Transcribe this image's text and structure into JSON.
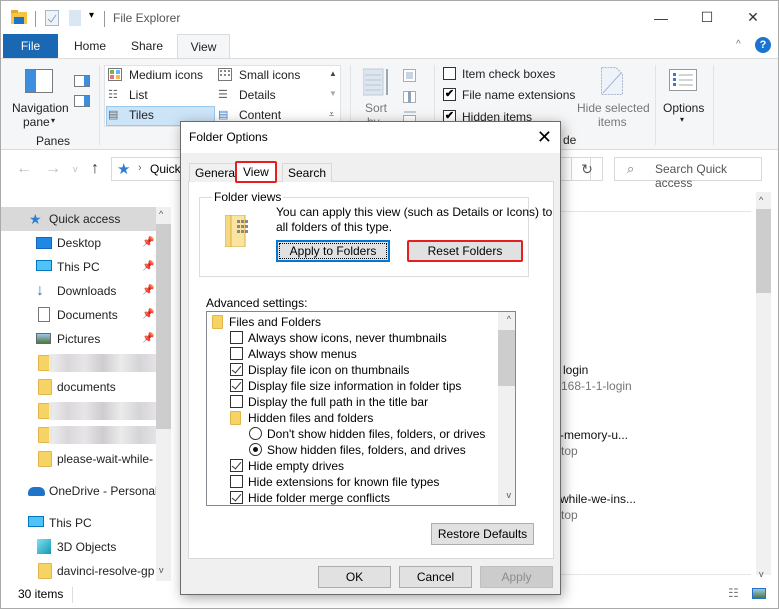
{
  "window": {
    "title": "File Explorer",
    "controls": {
      "minimize": "—",
      "maximize": "☐",
      "close": "✕"
    },
    "help": "?"
  },
  "ribbon": {
    "tabs": [
      {
        "label": "File"
      },
      {
        "label": "Home"
      },
      {
        "label": "Share"
      },
      {
        "label": "View",
        "active": true
      }
    ],
    "panes": {
      "navigation_pane": "Navigation",
      "navigation_pane_2": "pane",
      "group_label": "Panes"
    },
    "layout": {
      "items": [
        "Medium icons",
        "Small icons",
        "List",
        "Details",
        "Tiles",
        "Content"
      ],
      "selected": "Tiles"
    },
    "current_view": {
      "sort_by": "Sort",
      "sort_by_2": "by"
    },
    "show_hide": {
      "item_check_boxes": {
        "label": "Item check boxes",
        "checked": false
      },
      "file_name_extensions": {
        "label": "File name extensions",
        "checked": true
      },
      "hidden_items": {
        "label": "Hidden items",
        "checked": true
      },
      "group_label_fragment": "de",
      "hide_selected": "Hide selected",
      "hide_selected_2": "items"
    },
    "options": {
      "label": "Options"
    }
  },
  "address": {
    "path_fragment": "Quick",
    "search_placeholder": "Search Quick access"
  },
  "nav": {
    "items": [
      {
        "label": "Quick access",
        "selected": true
      },
      {
        "label": "Desktop",
        "pinned": true
      },
      {
        "label": "This PC",
        "pinned": true
      },
      {
        "label": "Downloads",
        "pinned": true
      },
      {
        "label": "Documents",
        "pinned": true
      },
      {
        "label": "Pictures",
        "pinned": true
      },
      {
        "label": "",
        "blurred": true
      },
      {
        "label": "documents"
      },
      {
        "label": "",
        "blurred": true
      },
      {
        "label": "",
        "blurred": true
      },
      {
        "label": "please-wait-while-"
      },
      {
        "label": "OneDrive - Personal"
      },
      {
        "label": "This PC"
      },
      {
        "label": "3D Objects"
      },
      {
        "label": "davinci-resolve-gp"
      }
    ]
  },
  "content": {
    "items": [
      {
        "name": "login",
        "sub": "168-1-1-login"
      },
      {
        "name": "-memory-u...",
        "sub": "top"
      },
      {
        "name": "while-we-ins...",
        "sub": "top"
      }
    ]
  },
  "status": {
    "item_count": "30 items"
  },
  "dialog": {
    "title": "Folder Options",
    "tabs": [
      "General",
      "View",
      "Search"
    ],
    "active_tab": "View",
    "folder_views": {
      "legend": "Folder views",
      "description_1": "You can apply this view (such as Details or Icons) to",
      "description_2": "all folders of this type.",
      "apply_button": "Apply to Folders",
      "reset_button": "Reset Folders"
    },
    "advanced_label": "Advanced settings:",
    "tree": [
      {
        "type": "folder",
        "label": "Files and Folders",
        "level": 0
      },
      {
        "type": "checkbox",
        "label": "Always show icons, never thumbnails",
        "checked": false
      },
      {
        "type": "checkbox",
        "label": "Always show menus",
        "checked": false
      },
      {
        "type": "checkbox",
        "label": "Display file icon on thumbnails",
        "checked": true
      },
      {
        "type": "checkbox",
        "label": "Display file size information in folder tips",
        "checked": true
      },
      {
        "type": "checkbox",
        "label": "Display the full path in the title bar",
        "checked": false
      },
      {
        "type": "folder",
        "label": "Hidden files and folders",
        "level": 1
      },
      {
        "type": "radio",
        "label": "Don't show hidden files, folders, or drives",
        "checked": false
      },
      {
        "type": "radio",
        "label": "Show hidden files, folders, and drives",
        "checked": true
      },
      {
        "type": "checkbox",
        "label": "Hide empty drives",
        "checked": true
      },
      {
        "type": "checkbox",
        "label": "Hide extensions for known file types",
        "checked": false
      },
      {
        "type": "checkbox",
        "label": "Hide folder merge conflicts",
        "checked": true
      }
    ],
    "restore_defaults": "Restore Defaults",
    "ok": "OK",
    "cancel": "Cancel",
    "apply": "Apply"
  },
  "colors": {
    "accent": "#1a68b3",
    "highlight": "#e51f1f",
    "selection": "#cce4f7"
  }
}
